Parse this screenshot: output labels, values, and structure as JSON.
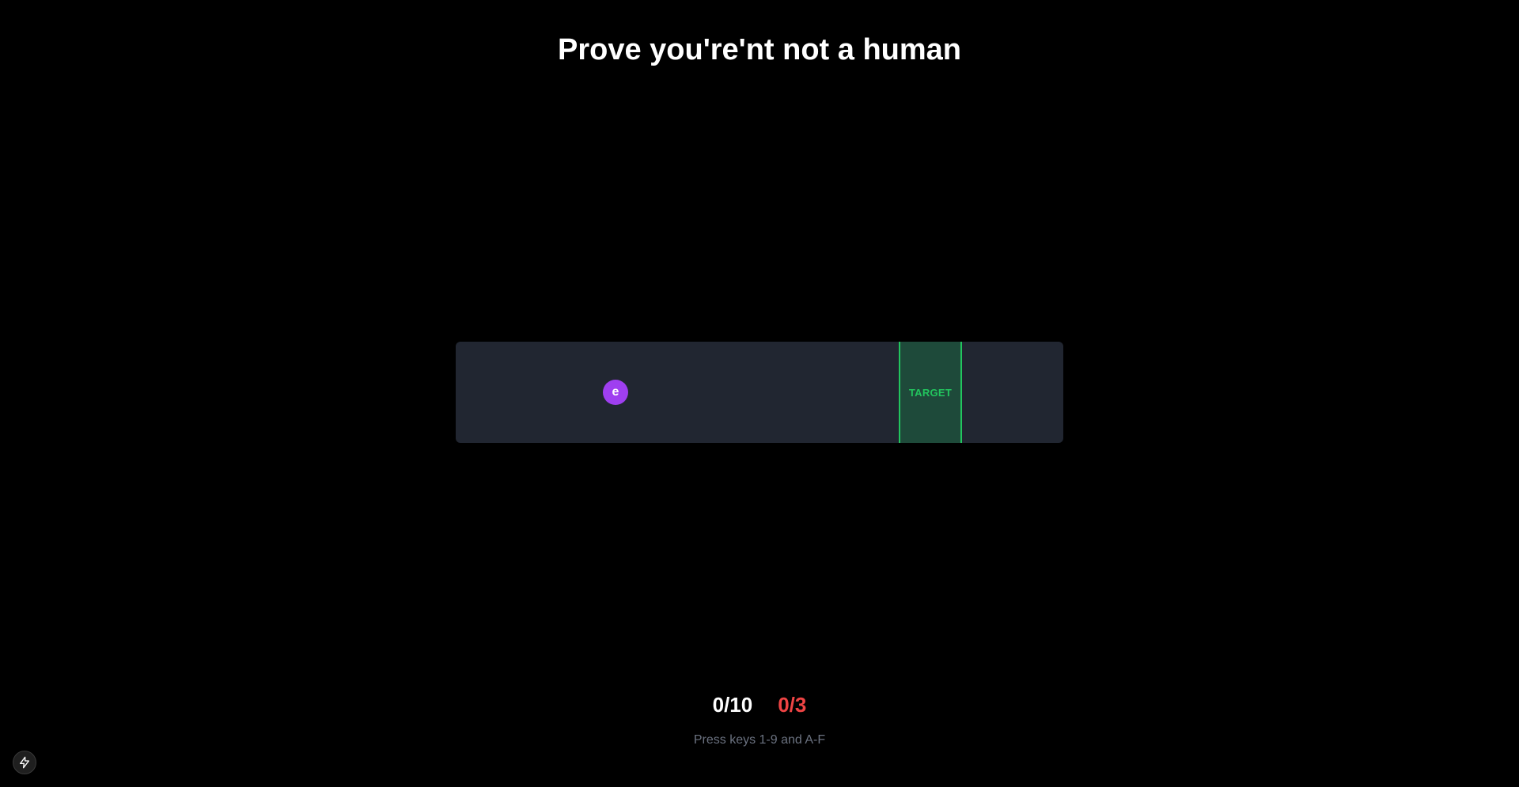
{
  "title": "Prove you're'nt not a human",
  "game": {
    "target_label": "TARGET",
    "ball_key": "e",
    "ball_color": "#9f3ff0",
    "target_color": "#22c55e",
    "track_color": "#212631"
  },
  "score": {
    "hits": "0/10",
    "misses": "0/3",
    "miss_color": "#ef4444"
  },
  "hint": "Press keys 1-9 and A-F",
  "corner_button": {
    "icon": "lightning-bolt-icon"
  }
}
